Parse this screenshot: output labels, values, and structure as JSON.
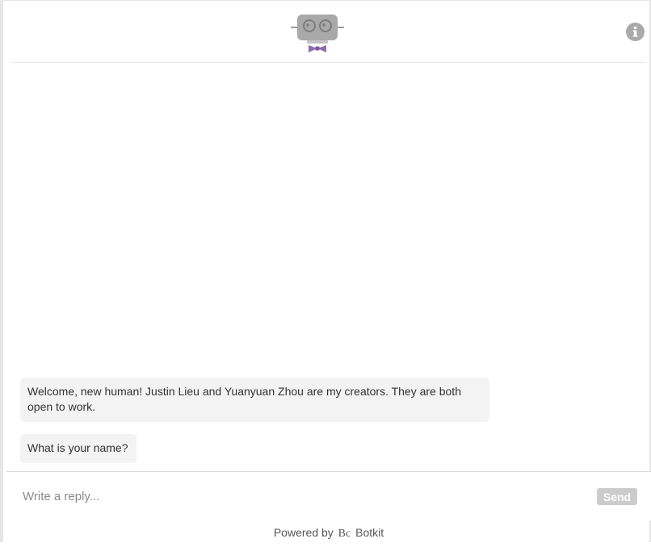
{
  "app": {
    "logo": "robot-bowtie-icon",
    "info": "info-icon"
  },
  "messages": [
    {
      "from": "bot",
      "text": "Welcome, new human! Justin Lieu and Yuanyuan Zhou are my creators. They are both open to work."
    },
    {
      "from": "bot",
      "text": "What is your name?"
    }
  ],
  "composer": {
    "placeholder": "Write a reply...",
    "value": "",
    "send_label": "Send"
  },
  "footer": {
    "prefix": "Powered by",
    "brand_mark": "Bc",
    "brand_name": "Botkit"
  },
  "colors": {
    "bubble_bg": "#f3f3f3",
    "send_button": "#cccccc",
    "logo_gray": "#a9a9a9",
    "bowtie": "#8e6bb0"
  }
}
